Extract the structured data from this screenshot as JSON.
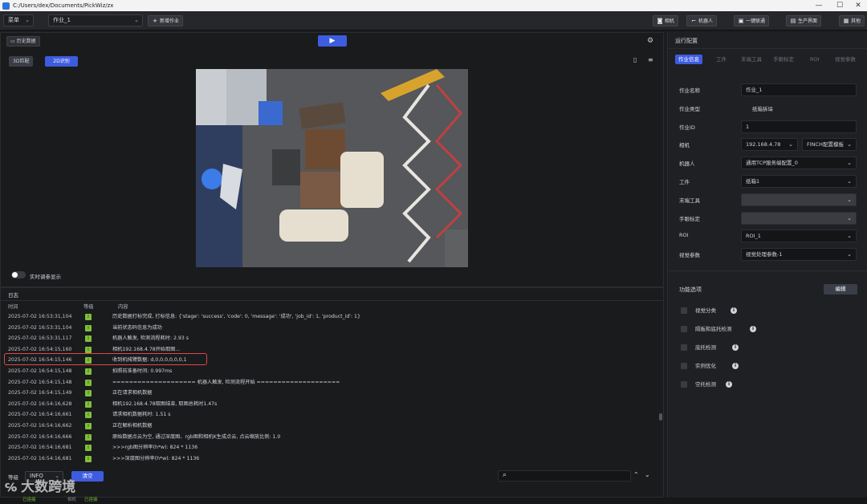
{
  "window": {
    "title": "C:/Users/dex/Documents/PickWiz/zx",
    "minimize": "—",
    "maximize": "☐",
    "close": "✕"
  },
  "toolbar": {
    "menu_label": "菜单",
    "job_select": "作业_1",
    "new_job": "新增作业",
    "camera": "相机",
    "robot": "机器人",
    "one_click": "一键联通",
    "production": "生产界面",
    "other": "其他"
  },
  "left": {
    "history_button": "历史数据",
    "mode_3d": "3D匹配",
    "mode_2d": "2D识别",
    "realtime_toggle": "实时调参显示"
  },
  "log": {
    "title": "日志",
    "col_time": "时间",
    "col_level": "等级",
    "col_content": "内容",
    "rows": [
      {
        "time": "2025-07-02 16:53:31,104",
        "level": "I",
        "msg": "历史数据打标完成, 打标信息: {'stage': 'success', 'code': 0, 'message': '成功', 'job_id': 1, 'product_id': 1}"
      },
      {
        "time": "2025-07-02 16:53:31,104",
        "level": "I",
        "msg": "当前状态码信息为成功"
      },
      {
        "time": "2025-07-02 16:53:31,117",
        "level": "I",
        "msg": "机器人触发, 检测流程耗时: 2.93 s"
      },
      {
        "time": "2025-07-02 16:54:15,160",
        "level": "I",
        "msg": "相机192.168.4.78开始取图..."
      },
      {
        "time": "2025-07-02 16:54:15,146",
        "level": "I",
        "msg": "收到机械臂数据: d,0,0,0,0,0,0,1"
      },
      {
        "time": "2025-07-02 16:54:15,148",
        "level": "I",
        "msg": "拍照前准备时间: 0.997ms"
      },
      {
        "time": "2025-07-02 16:54:15,148",
        "level": "I",
        "msg": "==================== 机器人触发, 检测流程开始 ===================="
      },
      {
        "time": "2025-07-02 16:54:15,149",
        "level": "I",
        "msg": "正在请求相机数据"
      },
      {
        "time": "2025-07-02 16:54:16,628",
        "level": "I",
        "msg": "相机192.168.4.78取图结束, 取图总耗时1.47s"
      },
      {
        "time": "2025-07-02 16:54:16,661",
        "level": "I",
        "msg": "请求相机数据耗时: 1.51 s"
      },
      {
        "time": "2025-07-02 16:54:16,662",
        "level": "I",
        "msg": "正在解析相机数据"
      },
      {
        "time": "2025-07-02 16:54:16,666",
        "level": "I",
        "msg": "原始数据点云为空, 通过深度图、rgb图和相机K生成点云, 点云缩放比例: 1.0"
      },
      {
        "time": "2025-07-02 16:54:16,681",
        "level": "I",
        "msg": ">>>rgb图分辨率(h*w): 824 * 1136"
      },
      {
        "time": "2025-07-02 16:54:16,681",
        "level": "I",
        "msg": ">>>深度图分辨率(h*w): 824 * 1136"
      }
    ],
    "level_label": "等级",
    "level_value": "INFO",
    "clear_button": "清空"
  },
  "status": {
    "left": "已连接",
    "mid": "相机",
    "mid2": "已连接"
  },
  "watermark": "大数跨境",
  "right": {
    "title": "运行配置",
    "tabs": [
      "作业信息",
      "工件",
      "末端工具",
      "手眼标定",
      "ROI",
      "视觉参数"
    ],
    "fields": [
      {
        "label": "作业名称",
        "value": "作业_1",
        "kind": "input"
      },
      {
        "label": "作业类型",
        "value": "纸箱拆垛",
        "kind": "plain"
      },
      {
        "label": "作业ID",
        "value": "1",
        "kind": "input"
      },
      {
        "label": "相机",
        "value": "192.168.4.78",
        "kind": "camera",
        "extra": "FINCH配置模板"
      },
      {
        "label": "机器人",
        "value": "通用TCP服务端配置_0",
        "kind": "select"
      },
      {
        "label": "工件",
        "value": "纸箱1",
        "kind": "select"
      },
      {
        "label": "末端工具",
        "value": "",
        "kind": "select"
      },
      {
        "label": "手眼标定",
        "value": "",
        "kind": "select"
      },
      {
        "label": "ROI",
        "value": "ROI_1",
        "kind": "select"
      },
      {
        "label": "视觉参数",
        "value": "视觉处理参数-1",
        "kind": "select"
      }
    ],
    "func_title": "功能选项",
    "edit_button": "编辑",
    "options": [
      "视觉分类",
      "隔板和底托检测",
      "底托检测",
      "实例优化",
      "空托检测"
    ]
  }
}
